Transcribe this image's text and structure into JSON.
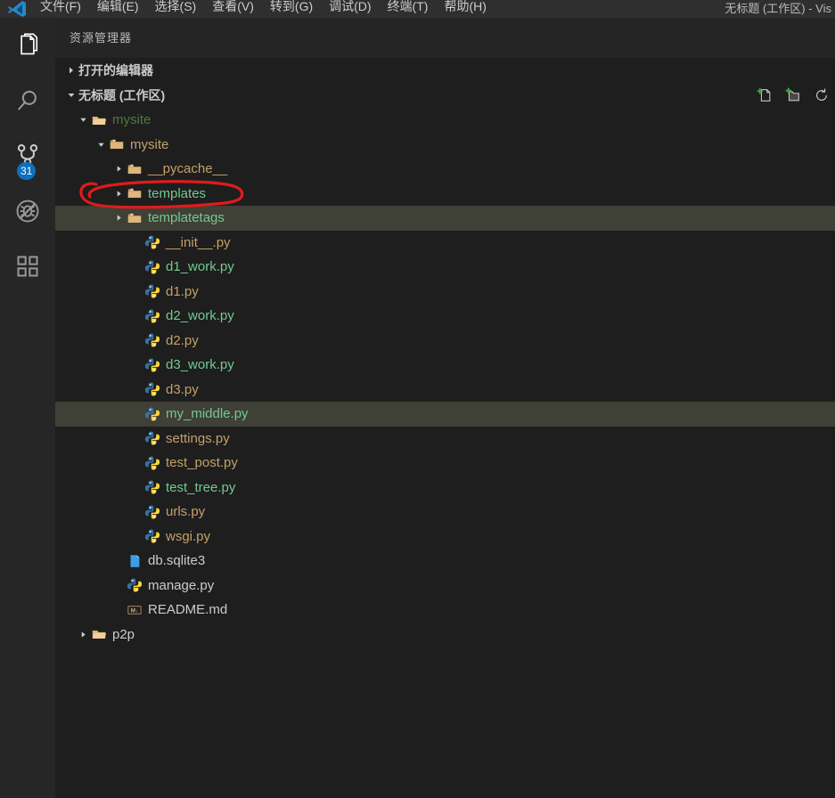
{
  "window": {
    "title": "无标题 (工作区) - Vis",
    "logo_icon": "vscode-logo-icon"
  },
  "menubar": {
    "items": [
      {
        "label": "文件(F)",
        "name": "menu-file"
      },
      {
        "label": "编辑(E)",
        "name": "menu-edit"
      },
      {
        "label": "选择(S)",
        "name": "menu-selection"
      },
      {
        "label": "查看(V)",
        "name": "menu-view"
      },
      {
        "label": "转到(G)",
        "name": "menu-go"
      },
      {
        "label": "调试(D)",
        "name": "menu-debug"
      },
      {
        "label": "终端(T)",
        "name": "menu-terminal"
      },
      {
        "label": "帮助(H)",
        "name": "menu-help"
      }
    ]
  },
  "activitybar": {
    "items": [
      {
        "name": "activitybar-explorer",
        "icon": "files-icon",
        "badge": ""
      },
      {
        "name": "activitybar-search",
        "icon": "search-icon",
        "badge": ""
      },
      {
        "name": "activitybar-source-control",
        "icon": "source-control-icon",
        "badge": "31"
      },
      {
        "name": "activitybar-run-debug",
        "icon": "debug-disabled-icon",
        "badge": ""
      },
      {
        "name": "activitybar-extensions",
        "icon": "extensions-icon",
        "badge": ""
      }
    ],
    "badge_color": "#0e70c0"
  },
  "sidebar": {
    "title": "资源管理器",
    "sections": [
      {
        "name": "section-open-editors",
        "label": "打开的编辑器",
        "expanded": false
      },
      {
        "name": "section-workspace",
        "label": "无标题 (工作区)",
        "expanded": true
      }
    ],
    "actions": [
      {
        "name": "new-file-icon",
        "title": "新建文件"
      },
      {
        "name": "new-folder-icon",
        "title": "新建文件夹"
      },
      {
        "name": "refresh-icon",
        "title": "刷新"
      }
    ]
  },
  "tree": {
    "rows": [
      {
        "name": "tree-item-mysite-root",
        "label": "mysite",
        "kind": "folder-root",
        "indent": 1,
        "arrow": "down",
        "color": "c-green",
        "highlight": false
      },
      {
        "name": "tree-item-mysite",
        "label": "mysite",
        "kind": "folder",
        "indent": 2,
        "arrow": "down",
        "color": "c-tan",
        "highlight": false
      },
      {
        "name": "tree-item-pycache",
        "label": "__pycache__",
        "kind": "folder",
        "indent": 3,
        "arrow": "right",
        "color": "c-tan",
        "highlight": false
      },
      {
        "name": "tree-item-templates",
        "label": "templates",
        "kind": "folder",
        "indent": 3,
        "arrow": "right",
        "color": "c-green2",
        "highlight": false
      },
      {
        "name": "tree-item-templatetags",
        "label": "templatetags",
        "kind": "folder",
        "indent": 3,
        "arrow": "right",
        "color": "c-green2",
        "highlight": true
      },
      {
        "name": "tree-item-init-py",
        "label": "__init__.py",
        "kind": "python",
        "indent": 4,
        "arrow": "none",
        "color": "c-tan",
        "highlight": false
      },
      {
        "name": "tree-item-d1-work-py",
        "label": "d1_work.py",
        "kind": "python",
        "indent": 4,
        "arrow": "none",
        "color": "c-green2",
        "highlight": false
      },
      {
        "name": "tree-item-d1-py",
        "label": "d1.py",
        "kind": "python",
        "indent": 4,
        "arrow": "none",
        "color": "c-tan",
        "highlight": false
      },
      {
        "name": "tree-item-d2-work-py",
        "label": "d2_work.py",
        "kind": "python",
        "indent": 4,
        "arrow": "none",
        "color": "c-green2",
        "highlight": false
      },
      {
        "name": "tree-item-d2-py",
        "label": "d2.py",
        "kind": "python",
        "indent": 4,
        "arrow": "none",
        "color": "c-tan",
        "highlight": false
      },
      {
        "name": "tree-item-d3-work-py",
        "label": "d3_work.py",
        "kind": "python",
        "indent": 4,
        "arrow": "none",
        "color": "c-green2",
        "highlight": false
      },
      {
        "name": "tree-item-d3-py",
        "label": "d3.py",
        "kind": "python",
        "indent": 4,
        "arrow": "none",
        "color": "c-tan",
        "highlight": false
      },
      {
        "name": "tree-item-my-middle-py",
        "label": "my_middle.py",
        "kind": "python",
        "indent": 4,
        "arrow": "none",
        "color": "c-green2",
        "highlight": true
      },
      {
        "name": "tree-item-settings-py",
        "label": "settings.py",
        "kind": "python",
        "indent": 4,
        "arrow": "none",
        "color": "c-tan",
        "highlight": false
      },
      {
        "name": "tree-item-test-post-py",
        "label": "test_post.py",
        "kind": "python",
        "indent": 4,
        "arrow": "none",
        "color": "c-tan",
        "highlight": false
      },
      {
        "name": "tree-item-test-tree-py",
        "label": "test_tree.py",
        "kind": "python",
        "indent": 4,
        "arrow": "none",
        "color": "c-green2",
        "highlight": false
      },
      {
        "name": "tree-item-urls-py",
        "label": "urls.py",
        "kind": "python",
        "indent": 4,
        "arrow": "none",
        "color": "c-tan",
        "highlight": false
      },
      {
        "name": "tree-item-wsgi-py",
        "label": "wsgi.py",
        "kind": "python",
        "indent": 4,
        "arrow": "none",
        "color": "c-tan",
        "highlight": false
      },
      {
        "name": "tree-item-db-sqlite3",
        "label": "db.sqlite3",
        "kind": "database",
        "indent": 3,
        "arrow": "none",
        "color": "c-white",
        "highlight": false
      },
      {
        "name": "tree-item-manage-py",
        "label": "manage.py",
        "kind": "python",
        "indent": 3,
        "arrow": "none",
        "color": "c-white",
        "highlight": false
      },
      {
        "name": "tree-item-readme-md",
        "label": "README.md",
        "kind": "markdown",
        "indent": 3,
        "arrow": "none",
        "color": "c-white",
        "highlight": false
      },
      {
        "name": "tree-item-p2p",
        "label": "p2p",
        "kind": "folder-root",
        "indent": 1,
        "arrow": "right",
        "color": "c-white",
        "highlight": false
      }
    ]
  },
  "annotation": {
    "name": "red-ellipse-annotation",
    "target": "templates",
    "color": "#e01b1b"
  }
}
